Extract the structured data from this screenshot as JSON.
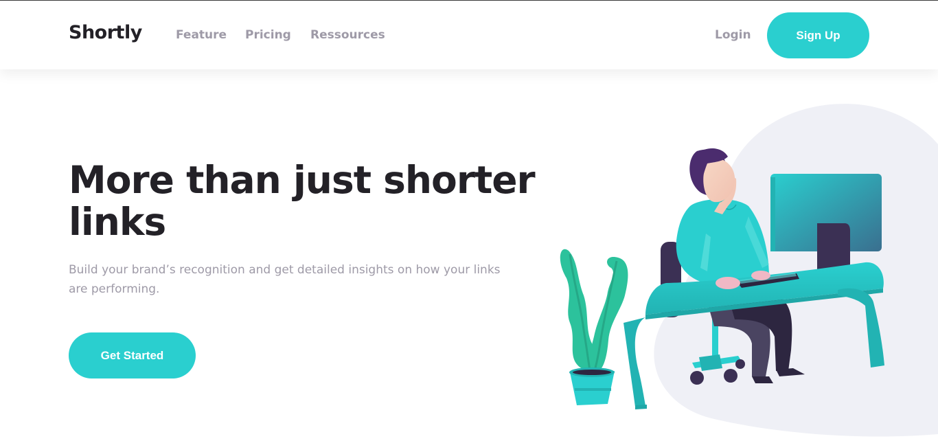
{
  "header": {
    "logo": "Shortly",
    "nav": [
      {
        "label": "Feature"
      },
      {
        "label": "Pricing"
      },
      {
        "label": "Ressources"
      }
    ],
    "login_label": "Login",
    "signup_label": "Sign Up"
  },
  "hero": {
    "title": "More than just shorter links",
    "subtitle": "Build your brand’s recognition and get detailed insights on how your links are performing.",
    "cta_label": "Get Started"
  },
  "colors": {
    "accent": "#2acfcf",
    "dark": "#232127",
    "gray": "#9e9aa7",
    "blob": "#eff0f6",
    "plant": "#2cc29c",
    "hair": "#4b2c6e"
  }
}
